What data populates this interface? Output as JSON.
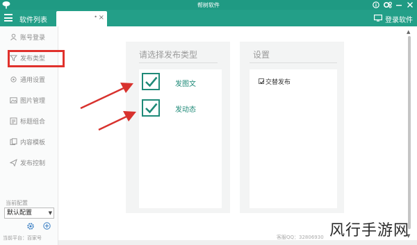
{
  "window": {
    "title": "帮树软件"
  },
  "header": {
    "software_list_label": "软件列表",
    "login_label": "登录软件",
    "tab_close": "×",
    "tab_dot": "•"
  },
  "sidebar": {
    "items": [
      {
        "label": "账号登录",
        "icon": "user-icon"
      },
      {
        "label": "发布类型",
        "icon": "filter-icon"
      },
      {
        "label": "通用设置",
        "icon": "settings-icon"
      },
      {
        "label": "图片管理",
        "icon": "image-icon"
      },
      {
        "label": "标题组合",
        "icon": "list-icon"
      },
      {
        "label": "内容模板",
        "icon": "template-icon"
      },
      {
        "label": "发布控制",
        "icon": "send-icon"
      }
    ],
    "config_label": "当前配置",
    "config_value": "默认配置",
    "platform_text": "当前平台：百家号"
  },
  "publish_type": {
    "title": "请选择发布类型",
    "options": [
      {
        "label": "发图文",
        "checked": true
      },
      {
        "label": "发动态",
        "checked": true
      }
    ]
  },
  "settings": {
    "title": "设置",
    "options": [
      {
        "label": "交替发布",
        "checked": true
      }
    ]
  },
  "footer": {
    "qq_text": "客服QQ：32806930"
  },
  "watermark": "风行手游网",
  "colors": {
    "accent": "#1f9a83",
    "check_green": "#1f8a78",
    "highlight_red": "#e0312c"
  }
}
